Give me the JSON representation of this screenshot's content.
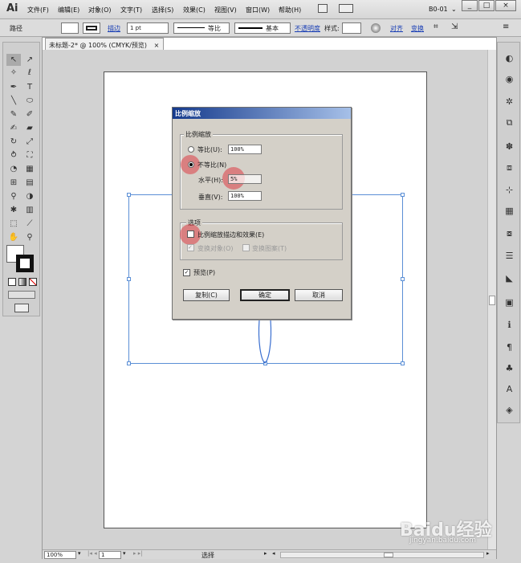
{
  "app": {
    "logo": "Ai"
  },
  "menu": [
    "文件(F)",
    "编辑(E)",
    "对象(O)",
    "文字(T)",
    "选择(S)",
    "效果(C)",
    "视图(V)",
    "窗口(W)",
    "帮助(H)"
  ],
  "workspace": "B0-01",
  "window_controls": {
    "minimize": "_",
    "maximize": "□",
    "close": "×"
  },
  "control_bar": {
    "selection_label": "路径",
    "stroke_link": "描边",
    "stroke_weight": "1 pt",
    "stroke_profile": "等比",
    "brush": "基本",
    "opacity_link": "不透明度",
    "style_label": "样式:",
    "align_link": "对齐",
    "transform_link": "变换"
  },
  "document": {
    "tab_title": "未标题-2* @ 100% (CMYK/预览)",
    "tab_close": "×"
  },
  "dialog": {
    "title": "比例缩放",
    "scale_group": "比例缩放",
    "uniform_label": "等比(U):",
    "uniform_value": "100%",
    "nonuniform_label": "不等比(N)",
    "horizontal_label": "水平(H):",
    "horizontal_value": "5%",
    "vertical_label": "垂直(V):",
    "vertical_value": "100%",
    "options_group": "选项",
    "scale_strokes_label": "比例缩放描边和效果(E)",
    "transform_objects_label": "变换对象(O)",
    "transform_patterns_label": "变换图案(T)",
    "preview_label": "预览(P)",
    "copy_button": "复制(C)",
    "ok_button": "确定",
    "cancel_button": "取消"
  },
  "status": {
    "zoom": "100%",
    "page": "1",
    "mode": "选择"
  },
  "watermark": {
    "brand": "Baidu经验",
    "url": "jingyan.baidu.com"
  },
  "colors": {
    "selection": "#5b8fd6",
    "highlight": "#dc3c46"
  }
}
